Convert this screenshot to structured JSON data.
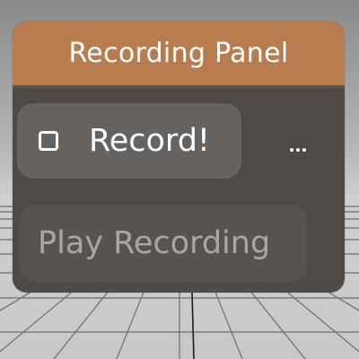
{
  "panel": {
    "title": "Recording Panel",
    "header_color": "#b87c4f",
    "body_color": "#4f4a47"
  },
  "record_button": {
    "label": "Record!",
    "checked": false,
    "checkbox_icon": "checkbox-unchecked-icon"
  },
  "more_button": {
    "icon": "more-horizontal-icon"
  },
  "play_button": {
    "label": "Play Recording",
    "enabled": false
  }
}
